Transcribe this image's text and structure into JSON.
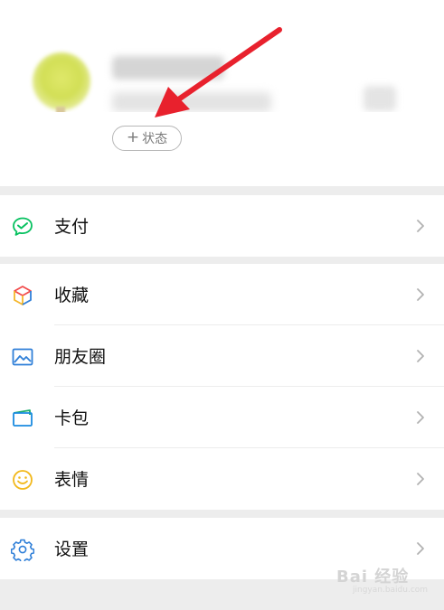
{
  "profile": {
    "status_button": {
      "plus": "+",
      "label": "状态"
    }
  },
  "menu": {
    "pay": {
      "label": "支付",
      "icon": "wechat-pay-icon",
      "color": "#07c160"
    },
    "favorites": {
      "label": "收藏",
      "icon": "cube-icon"
    },
    "moments": {
      "label": "朋友圈",
      "icon": "image-icon",
      "color": "#2f7fd8"
    },
    "cards": {
      "label": "卡包",
      "icon": "card-wallet-icon",
      "color": "#1a8be0"
    },
    "stickers": {
      "label": "表情",
      "icon": "smiley-icon",
      "color": "#f2b81b"
    },
    "settings": {
      "label": "设置",
      "icon": "gear-icon",
      "color": "#2f7fd8"
    }
  },
  "annotation": {
    "arrow_color": "#e8212d"
  },
  "watermark": {
    "text": "Bai 经验",
    "sub": "jingyan.baidu.com"
  }
}
